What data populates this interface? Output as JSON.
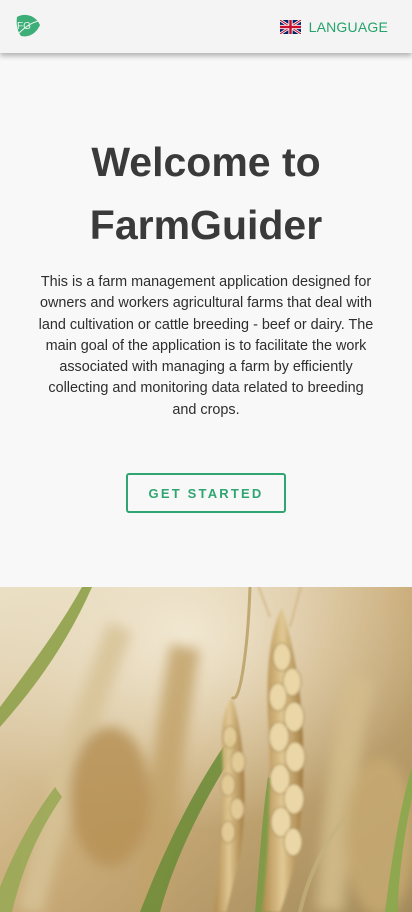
{
  "header": {
    "logo_text": "FG",
    "logo_icon": "leaf-logo-icon",
    "language_label": "LANGUAGE",
    "language_flag_icon": "uk-flag-icon"
  },
  "hero": {
    "title": "Welcome to FarmGuider",
    "description": "This is a farm management application designed for owners and workers agricultural farms that deal with land cultivation or cattle breeding - beef or dairy. The main goal of the application is to facilitate the work associated with managing a farm by efficiently collecting and monitoring data related to breeding and crops.",
    "cta_label": "GET STARTED"
  },
  "colors": {
    "accent": "#2fa672",
    "title": "#3a3a3a",
    "background": "#f8f8f8"
  }
}
